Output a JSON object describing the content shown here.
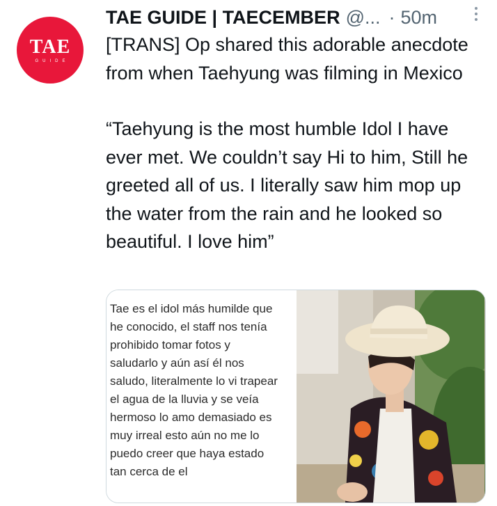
{
  "account": {
    "avatar_text": "TAE",
    "avatar_subtext": "GUIDE",
    "display_name": "TAE GUIDE | TAECEMBER",
    "handle": "@...",
    "separator": "·",
    "time": "50m"
  },
  "tweet": {
    "intro": "[TRANS] Op shared this adorable anecdote from when Taehyung was filming in Mexico",
    "quote": "“Taehyung is the most humble Idol I have ever met. We couldn’t say Hi to him, Still he greeted all of us. I literally saw him mop up the water from the rain and he looked so beautiful. I love him”"
  },
  "media": {
    "screenshot_lines": [
      "Tae es el idol más humilde que",
      "he conocido, el staff nos tenía",
      "prohibido tomar fotos y",
      "saludarlo y aún así él nos",
      "saludo, literalmente lo vi trapear",
      "el agua de la lluvia y se veía",
      "hermoso lo amo demasiado es",
      "muy irreal esto aún no me lo",
      "puedo creer que haya estado",
      "tan cerca de el"
    ]
  },
  "colors": {
    "avatar_bg": "#e8173a",
    "text": "#0f1419",
    "secondary": "#536471",
    "border": "#cfd9de"
  }
}
